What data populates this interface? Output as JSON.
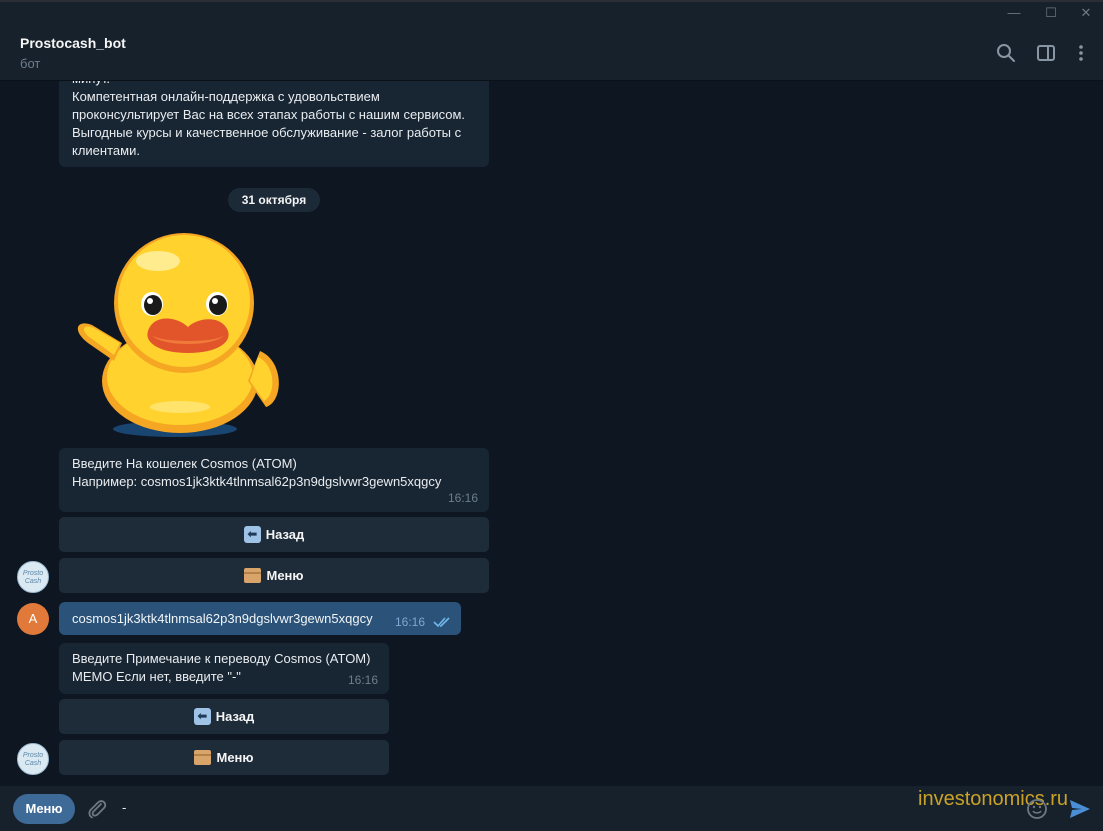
{
  "window": {
    "minimize": "—",
    "maximize": "☐",
    "close": "✕"
  },
  "header": {
    "title": "Prostocash_bot",
    "subtitle": "бот"
  },
  "messages": {
    "intro_text": "минут.\nКомпетентная онлайн-поддержка с удовольствием проконсультирует Вас на всех этапах работы с нашим сервисом. Выгодные курсы и качественное обслуживание - залог работы с клиентами.",
    "date": "31 октября",
    "wallet_prompt": "Введите На кошелек Cosmos (ATOM)\nНапример: cosmos1jk3ktk4tlnmsal62p3n9dgslvwr3gewn5xqgcy",
    "wallet_time": "16:16",
    "back_label": "Назад",
    "menu_label": "Меню",
    "user_wallet": "cosmos1jk3ktk4tlnmsal62p3n9dgslvwr3gewn5xqgcy",
    "user_time": "16:16",
    "memo_prompt": "Введите Примечание к переводу Cosmos (ATOM)\nMEMO Если нет, введите \"-\"",
    "memo_time": "16:16",
    "bot_avatar_text": "Prosto Cash",
    "user_avatar_letter": "A"
  },
  "composer": {
    "menu_button": "Меню",
    "input_value": "-",
    "watermark": "investonomics.ru"
  },
  "colors": {
    "background": "#0e1621",
    "incoming": "#182533",
    "outgoing": "#2b5278",
    "accent": "#3e6a98"
  }
}
